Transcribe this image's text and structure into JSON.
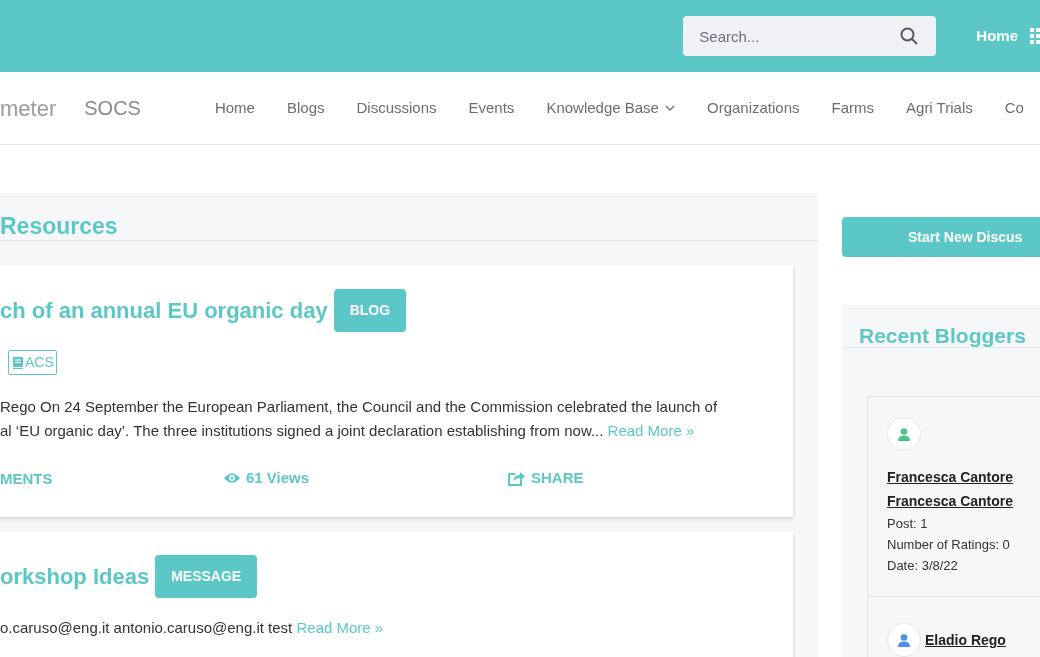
{
  "topbar": {
    "search": {
      "placeholder": "Search..."
    },
    "links": [
      "Home"
    ]
  },
  "navbar": {
    "brand": "meter",
    "site": "SOCS",
    "items": [
      {
        "label": "Home",
        "dropdown": false
      },
      {
        "label": "Blogs",
        "dropdown": false
      },
      {
        "label": "Discussions",
        "dropdown": false
      },
      {
        "label": "Events",
        "dropdown": false
      },
      {
        "label": "Knowledge Base",
        "dropdown": true
      },
      {
        "label": "Organizations",
        "dropdown": false
      },
      {
        "label": "Farms",
        "dropdown": false
      },
      {
        "label": "Agri Trials",
        "dropdown": false
      },
      {
        "label": "Co",
        "dropdown": false
      }
    ]
  },
  "resources": {
    "title": "Resources",
    "posts": [
      {
        "title": "ch of an annual EU organic day",
        "type": "BLOG",
        "tags": [
          "ACS"
        ],
        "lines": [
          "Rego On 24 September the European Parliament, the Council and the Commission celebrated the launch of",
          "al ‘EU organic day’. The three institutions signed a joint declaration establishing from now..."
        ],
        "read_more": "Read More »",
        "actions": [
          {
            "kind": "comments",
            "label": "MENTS"
          },
          {
            "kind": "views",
            "label": "61 Views"
          },
          {
            "kind": "share",
            "label": "SHARE"
          }
        ]
      },
      {
        "title": "orkshop Ideas",
        "type": "MESSAGE",
        "lines": [
          "o.caruso@eng.it antonio.caruso@eng.it test"
        ],
        "read_more": "Read More »"
      }
    ]
  },
  "sidebar": {
    "button": "Start New Discus",
    "bloggers": {
      "title": "Recent Bloggers",
      "items": [
        {
          "kind": "stacked",
          "color": "#4cc38a",
          "names": [
            "Francesca Cantore",
            "Francesca Cantore"
          ],
          "stats": [
            "Post: 1",
            "Number of Ratings: 0",
            "Date: 3/8/22"
          ]
        },
        {
          "kind": "inline",
          "color": "#4a90f0",
          "names": [
            "Eladio Rego"
          ]
        }
      ]
    }
  }
}
